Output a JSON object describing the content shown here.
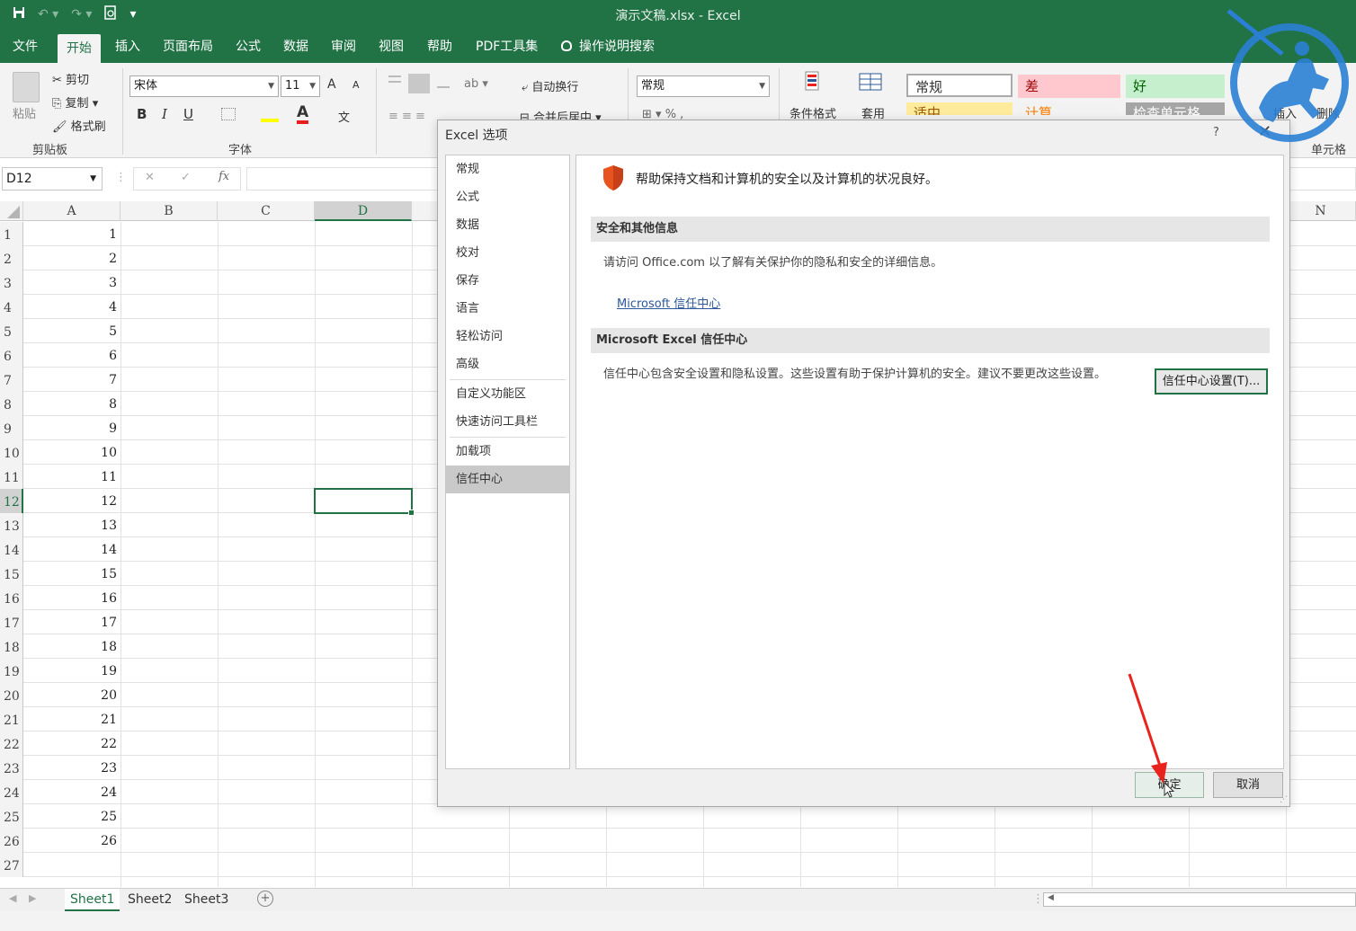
{
  "window": {
    "title": "演示文稿.xlsx  -  Excel"
  },
  "qat": {
    "save_icon": "save-icon",
    "undo_icon": "undo-icon",
    "redo_icon": "redo-icon",
    "preview_icon": "print-preview-icon",
    "customize": "▾"
  },
  "menu": {
    "tabs": [
      {
        "label": "文件"
      },
      {
        "label": "开始"
      },
      {
        "label": "插入"
      },
      {
        "label": "页面布局"
      },
      {
        "label": "公式"
      },
      {
        "label": "数据"
      },
      {
        "label": "审阅"
      },
      {
        "label": "视图"
      },
      {
        "label": "帮助"
      },
      {
        "label": "PDF工具集"
      },
      {
        "label": "操作说明搜索"
      }
    ]
  },
  "ribbon": {
    "clipboard": {
      "paste": "粘贴",
      "cut": "剪切",
      "copy": "复制",
      "format_painter": "格式刷",
      "group": "剪贴板"
    },
    "font": {
      "name": "宋体",
      "size": "11",
      "group": "字体",
      "grow": "A",
      "shrink": "A",
      "bold": "B",
      "italic": "I",
      "underline": "U",
      "font_color": "A",
      "phonetic": "文"
    },
    "alignment": {
      "wrap": "自动换行",
      "merge": "合并后居中"
    },
    "number": {
      "format": "常规",
      "percent": "%"
    },
    "styles": {
      "conditional": "条件格式",
      "table": "套用",
      "cells": [
        {
          "label": "常规",
          "bg": "#ffffff",
          "color": "#333333"
        },
        {
          "label": "差",
          "bg": "#ffc7ce",
          "color": "#9c0006"
        },
        {
          "label": "好",
          "bg": "#c6efce",
          "color": "#006100"
        },
        {
          "label": "适中",
          "bg": "#ffeb9c",
          "color": "#9c5700"
        },
        {
          "label": "计算",
          "bg": "#f2f2f2",
          "color": "#fa7d00"
        },
        {
          "label": "检查单元格",
          "bg": "#a5a5a5",
          "color": "#ffffff"
        }
      ]
    },
    "cells": {
      "insert": "插入",
      "delete": "删除",
      "group": "单元格"
    }
  },
  "formula": {
    "name_box": "D12",
    "cancel": "✕",
    "enter": "✓",
    "fx": "fx",
    "value": ""
  },
  "grid": {
    "columns": [
      "A",
      "B",
      "C",
      "D",
      "N"
    ],
    "selected_cell": "D12",
    "rows": [
      {
        "num": "1",
        "a": "1"
      },
      {
        "num": "2",
        "a": "2"
      },
      {
        "num": "3",
        "a": "3"
      },
      {
        "num": "4",
        "a": "4"
      },
      {
        "num": "5",
        "a": "5"
      },
      {
        "num": "6",
        "a": "6"
      },
      {
        "num": "7",
        "a": "7"
      },
      {
        "num": "8",
        "a": "8"
      },
      {
        "num": "9",
        "a": "9"
      },
      {
        "num": "10",
        "a": "10"
      },
      {
        "num": "11",
        "a": "11"
      },
      {
        "num": "12",
        "a": "12"
      },
      {
        "num": "13",
        "a": "13"
      },
      {
        "num": "14",
        "a": "14"
      },
      {
        "num": "15",
        "a": "15"
      },
      {
        "num": "16",
        "a": "16"
      },
      {
        "num": "17",
        "a": "17"
      },
      {
        "num": "18",
        "a": "18"
      },
      {
        "num": "19",
        "a": "19"
      },
      {
        "num": "20",
        "a": "20"
      },
      {
        "num": "21",
        "a": "21"
      },
      {
        "num": "22",
        "a": "22"
      },
      {
        "num": "23",
        "a": "23"
      },
      {
        "num": "24",
        "a": "24"
      },
      {
        "num": "25",
        "a": "25"
      },
      {
        "num": "26",
        "a": "26"
      },
      {
        "num": "27",
        "a": ""
      }
    ]
  },
  "sheets": {
    "tabs": [
      "Sheet1",
      "Sheet2",
      "Sheet3"
    ],
    "active": "Sheet1",
    "add": "+"
  },
  "dialog": {
    "title": "Excel 选项",
    "help": "?",
    "close": "✕",
    "nav": [
      {
        "label": "常规"
      },
      {
        "label": "公式"
      },
      {
        "label": "数据"
      },
      {
        "label": "校对"
      },
      {
        "label": "保存"
      },
      {
        "label": "语言"
      },
      {
        "label": "轻松访问"
      },
      {
        "label": "高级"
      },
      {
        "label": "自定义功能区"
      },
      {
        "label": "快速访问工具栏"
      },
      {
        "label": "加载项"
      },
      {
        "label": "信任中心"
      }
    ],
    "active_nav": "信任中心",
    "lead": "帮助保持文档和计算机的安全以及计算机的状况良好。",
    "section1": {
      "heading": "安全和其他信息",
      "text": "请访问 Office.com  以了解有关保护你的隐私和安全的详细信息。",
      "link": "Microsoft 信任中心"
    },
    "section2": {
      "heading": "Microsoft Excel 信任中心",
      "text": "信任中心包含安全设置和隐私设置。这些设置有助于保护计算机的安全。建议不要更改这些设置。",
      "button": "信任中心设置(T)..."
    },
    "ok": "确定",
    "cancel": "取消",
    "accent": "#217346",
    "shield_color": "#e8541e"
  },
  "overlay": {
    "arrow_color": "#e8231e",
    "logo_color": "#2a7fd4"
  }
}
